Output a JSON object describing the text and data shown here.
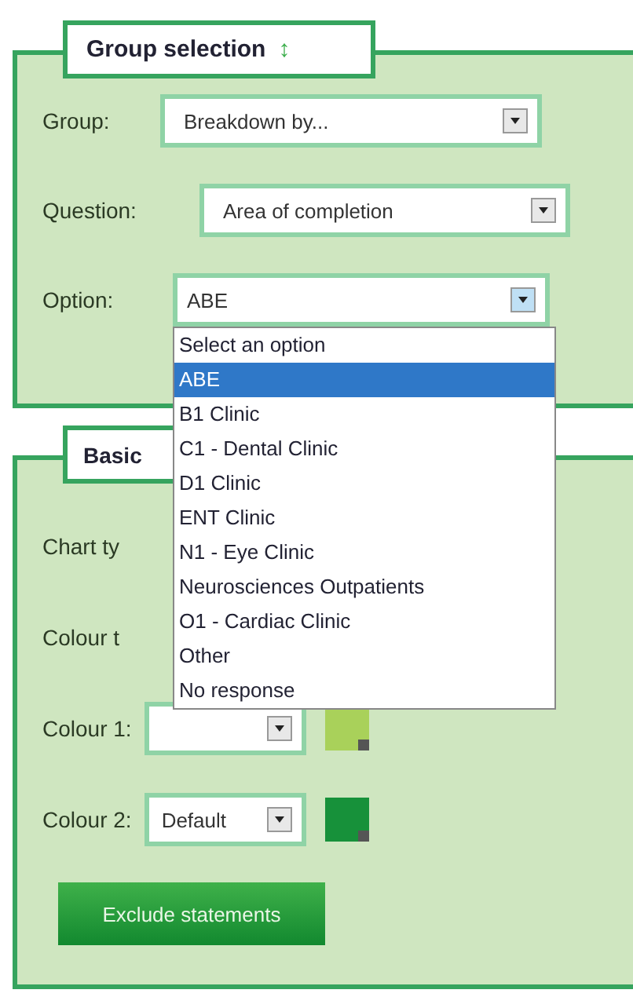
{
  "group_selection": {
    "title": "Group selection",
    "title_icon": "↕",
    "fields": [
      {
        "label": "Group:",
        "value": "Breakdown by..."
      },
      {
        "label": "Question:",
        "value": "Area of completion"
      },
      {
        "label": "Option:",
        "value": "ABE",
        "expanded": true
      }
    ],
    "options": [
      {
        "label": "Select an option",
        "selected": false
      },
      {
        "label": "ABE",
        "selected": true
      },
      {
        "label": "B1 Clinic",
        "selected": false
      },
      {
        "label": "C1 - Dental Clinic",
        "selected": false
      },
      {
        "label": "D1 Clinic",
        "selected": false
      },
      {
        "label": "ENT Clinic",
        "selected": false
      },
      {
        "label": "N1 - Eye Clinic",
        "selected": false
      },
      {
        "label": "Neurosciences Outpatients",
        "selected": false
      },
      {
        "label": "O1 - Cardiac Clinic",
        "selected": false
      },
      {
        "label": "Other",
        "selected": false
      },
      {
        "label": "No response",
        "selected": false
      }
    ]
  },
  "basic": {
    "title": "Basic",
    "rows": [
      {
        "kind": "label",
        "label": "Chart ty"
      },
      {
        "kind": "label",
        "label": "Colour t"
      },
      {
        "kind": "colour",
        "label": "Colour 1:",
        "color": "#a9d15a"
      },
      {
        "kind": "colour",
        "label": "Colour 2:",
        "value": "Default",
        "color": "#17913a"
      }
    ],
    "button": "Exclude statements"
  }
}
